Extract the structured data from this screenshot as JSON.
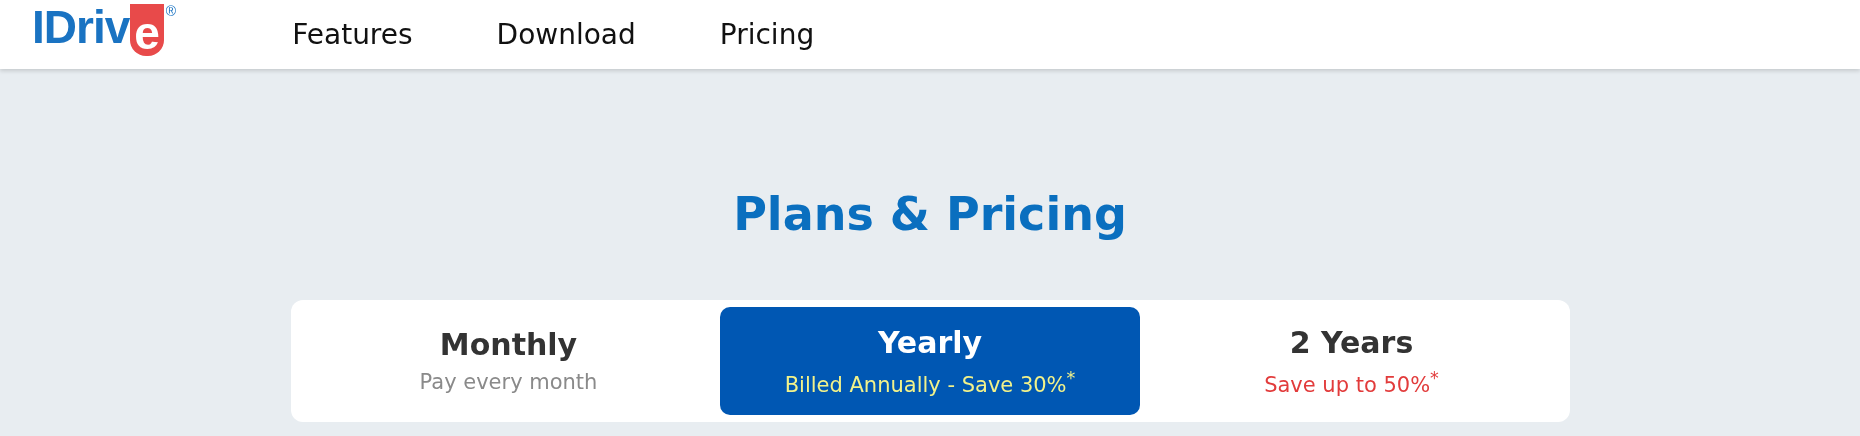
{
  "header": {
    "logo": {
      "text": "IDriv",
      "badge": "e",
      "mark": "®"
    },
    "nav": [
      {
        "label": "Features"
      },
      {
        "label": "Download"
      },
      {
        "label": "Pricing"
      }
    ]
  },
  "title": "Plans & Pricing",
  "tabs": [
    {
      "label": "Monthly",
      "note": "Pay every month",
      "color": "#8a8a8a",
      "selected": false
    },
    {
      "label": "Yearly",
      "note": "Billed Annually - Save 30%$^{*}$",
      "color": "#f2f28a",
      "selected": true
    },
    {
      "label": "2 Years",
      "note": "Save up to 50%$^{*}$",
      "color": "#e23b3b",
      "selected": false
    }
  ]
}
